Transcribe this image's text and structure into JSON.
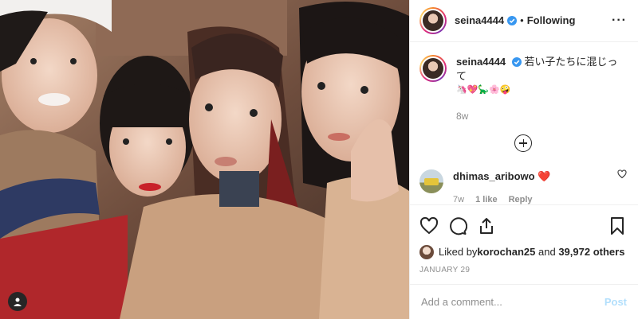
{
  "header": {
    "username": "seina4444",
    "separator": "•",
    "following_label": "Following",
    "more_label": "···"
  },
  "caption": {
    "username": "seina4444",
    "text": "若い子たちに混じって",
    "emoji": "🦄💖🦕🌸🤪",
    "time": "8w"
  },
  "comment": {
    "username": "dhimas_aribowo",
    "text": "❤️",
    "time": "7w",
    "likes": "1 like",
    "reply_label": "Reply"
  },
  "likes": {
    "prefix": "Liked by ",
    "user": "korochan25",
    "middle": " and ",
    "count": "39,972 others"
  },
  "date": "JANUARY 29",
  "add_comment": {
    "placeholder": "Add a comment...",
    "post_label": "Post"
  },
  "colors": {
    "text": "#262626",
    "muted": "#8e8e8e",
    "verified": "#3897f0",
    "post_disabled": "#b2dffc",
    "heart": "#ed4956"
  },
  "icons": [
    "heart-icon",
    "comment-icon",
    "share-icon",
    "bookmark-icon",
    "verified-icon",
    "user-tag-icon",
    "load-more-icon"
  ]
}
